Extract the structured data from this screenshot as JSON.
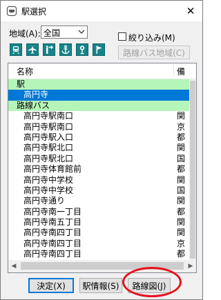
{
  "window": {
    "title": "駅選択",
    "close_glyph": "✕"
  },
  "filter": {
    "region_label": "地域(A):",
    "region_value": "全国",
    "narrow_label": "絞り込み(M)",
    "route_bus_region_button": "路線バス地域(C)"
  },
  "toolbar": {
    "icons": [
      "train-icon",
      "airplane-icon",
      "port-icon",
      "anchor-icon",
      "bus-stop-icon",
      "flag-icon"
    ],
    "accent": "#17848a"
  },
  "list": {
    "header_name": "名称",
    "header_note": "備",
    "rows": [
      {
        "name": "駅",
        "note": "",
        "kind": "group"
      },
      {
        "name": "高円寺",
        "note": "",
        "kind": "selected"
      },
      {
        "name": "路線バス",
        "note": "",
        "kind": "group"
      },
      {
        "name": "高円寺駅南口",
        "note": "関",
        "kind": "item"
      },
      {
        "name": "高円寺駅南口",
        "note": "京",
        "kind": "item"
      },
      {
        "name": "高円寺駅入口",
        "note": "都",
        "kind": "item"
      },
      {
        "name": "高円寺駅北口",
        "note": "関",
        "kind": "item"
      },
      {
        "name": "高円寺駅北口",
        "note": "国",
        "kind": "item"
      },
      {
        "name": "高円寺体育館前",
        "note": "都",
        "kind": "item"
      },
      {
        "name": "高円寺中学校",
        "note": "関",
        "kind": "item"
      },
      {
        "name": "高円寺中学校",
        "note": "国",
        "kind": "item"
      },
      {
        "name": "高円寺通り",
        "note": "関",
        "kind": "item"
      },
      {
        "name": "高円寺南一丁目",
        "note": "都",
        "kind": "item"
      },
      {
        "name": "高円寺南五丁目",
        "note": "関",
        "kind": "item"
      },
      {
        "name": "高円寺南四丁目",
        "note": "関",
        "kind": "item"
      },
      {
        "name": "高円寺南四丁目",
        "note": "京",
        "kind": "item"
      },
      {
        "name": "高円寺南四丁目",
        "note": "都",
        "kind": "item"
      }
    ],
    "group_color": "#b6f5b9",
    "selected_color": "#0078d7"
  },
  "buttons": {
    "ok": "決定(X)",
    "station_info": "駅情報(S)",
    "route_map": "路線図(J)"
  },
  "annotation": {
    "shape": "red-ellipse",
    "target": "route-map-button",
    "color": "#e8101b"
  }
}
